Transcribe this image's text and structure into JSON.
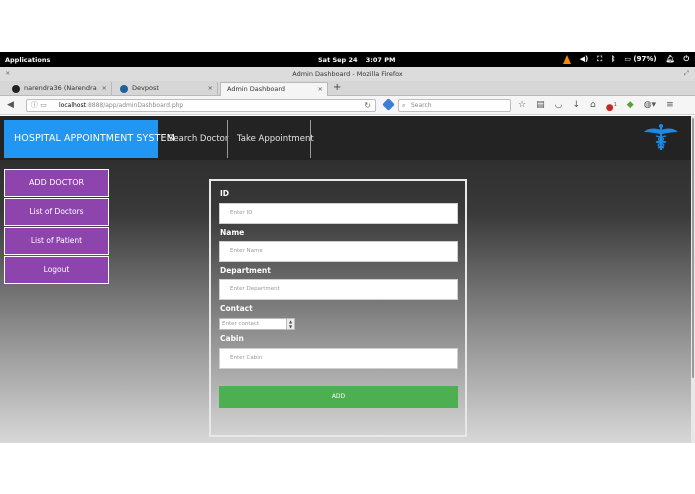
{
  "system_bar": {
    "applications": "Applications",
    "date": "Sat Sep 24",
    "time": "3:07 PM",
    "battery": "(97%)"
  },
  "window": {
    "title": "Admin Dashboard - Mozilla Firefox"
  },
  "browser": {
    "tabs": [
      {
        "label": "narendra36 (Narendra Do…",
        "icon": "github-icon"
      },
      {
        "label": "Devpost",
        "icon": "devpost-icon"
      },
      {
        "label": "Admin Dashboard",
        "icon": "none"
      }
    ],
    "url_host": "localhost",
    "url_path": ":8888/app/adminDashboard.php",
    "search_placeholder": "Search",
    "notification_badge": "1"
  },
  "site": {
    "brand": "HOSPITAL APPOINTMENT SYSTEM",
    "nav": [
      "Search Doctor",
      "Take Appointment"
    ],
    "logo_icon": "caduceus-icon",
    "brand_color": "#2196f3"
  },
  "sidebar": {
    "items": [
      "ADD DOCTOR",
      "List of Doctors",
      "List of Patient",
      "Logout"
    ],
    "color": "#8e44ad"
  },
  "form": {
    "fields": [
      {
        "label": "ID",
        "placeholder": "Enter ID"
      },
      {
        "label": "Name",
        "placeholder": "Enter Name"
      },
      {
        "label": "Department",
        "placeholder": "Enter Department"
      },
      {
        "label": "Contact",
        "placeholder": "Enter contact"
      },
      {
        "label": "Cabin",
        "placeholder": "Enter Cabin"
      }
    ],
    "submit_label": "ADD",
    "submit_color": "#4caf50"
  }
}
